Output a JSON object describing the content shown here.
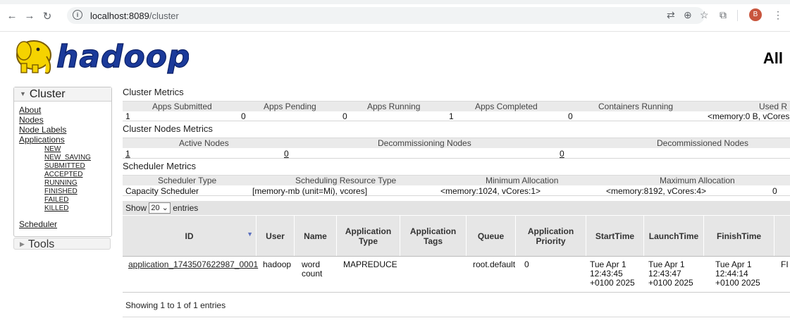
{
  "browser": {
    "url_host": "localhost:8089",
    "url_path": "/cluster",
    "avatar_letter": "B"
  },
  "header": {
    "logo_text": "hadoop",
    "page_title": "All"
  },
  "sidebar": {
    "cluster_label": "Cluster",
    "about": "About",
    "nodes": "Nodes",
    "node_labels": "Node Labels",
    "applications": "Applications",
    "app_states": [
      "NEW",
      "NEW_SAVING",
      "SUBMITTED",
      "ACCEPTED",
      "RUNNING",
      "FINISHED",
      "FAILED",
      "KILLED"
    ],
    "scheduler": "Scheduler",
    "tools_label": "Tools"
  },
  "cluster_metrics": {
    "title": "Cluster Metrics",
    "headers": [
      "Apps Submitted",
      "Apps Pending",
      "Apps Running",
      "Apps Completed",
      "Containers Running",
      "Used R"
    ],
    "values": [
      "1",
      "0",
      "0",
      "1",
      "0",
      "<memory:0 B, vCores"
    ]
  },
  "nodes_metrics": {
    "title": "Cluster Nodes Metrics",
    "headers": [
      "Active Nodes",
      "Decommissioning Nodes",
      "Decommissioned Nodes"
    ],
    "values": [
      "1",
      "0",
      "0"
    ]
  },
  "scheduler_metrics": {
    "title": "Scheduler Metrics",
    "headers": [
      "Scheduler Type",
      "Scheduling Resource Type",
      "Minimum Allocation",
      "Maximum Allocation"
    ],
    "values": [
      "Capacity Scheduler",
      "[memory-mb (unit=Mi), vcores]",
      "<memory:1024, vCores:1>",
      "<memory:8192, vCores:4>",
      "0"
    ]
  },
  "apps_table": {
    "show_prefix": "Show",
    "page_size": "20",
    "show_suffix": "entries",
    "columns": [
      "ID",
      "User",
      "Name",
      "Application Type",
      "Application Tags",
      "Queue",
      "Application Priority",
      "StartTime",
      "LaunchTime",
      "FinishTime"
    ],
    "row": {
      "id": "application_1743507622987_0001",
      "user": "hadoop",
      "name": "word count",
      "type": "MAPREDUCE",
      "tags": "",
      "queue": "root.default",
      "priority": "0",
      "start_time": "Tue Apr 1 12:43:45 +0100 2025",
      "launch_time": "Tue Apr 1 12:43:47 +0100 2025",
      "finish_time": "Tue Apr 1 12:44:14 +0100 2025",
      "state_partial": "FI"
    },
    "footer": "Showing 1 to 1 of 1 entries"
  }
}
